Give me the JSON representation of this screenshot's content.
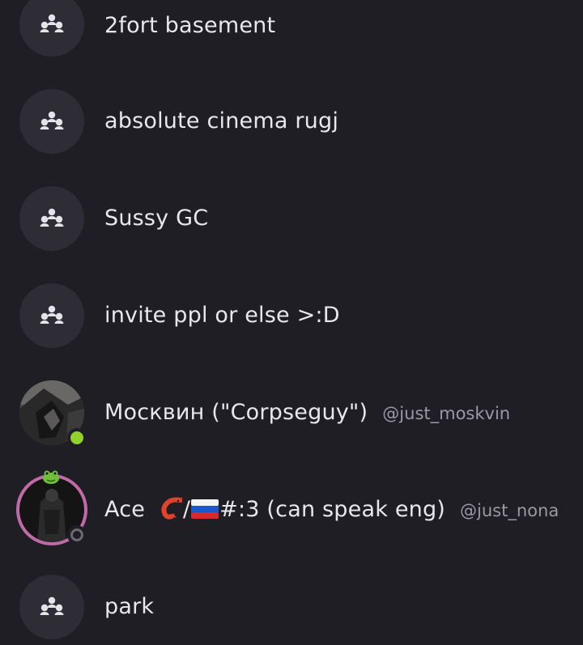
{
  "conversations": [
    {
      "type": "group",
      "name": "2fort basement",
      "icon": "group-icon"
    },
    {
      "type": "group",
      "name": "absolute cinema rugj",
      "icon": "group-icon"
    },
    {
      "type": "group",
      "name": "Sussy GC",
      "icon": "group-icon"
    },
    {
      "type": "group",
      "name": "invite ppl or else >:D",
      "icon": "group-icon"
    },
    {
      "type": "user",
      "name": "Москвин (\"Corpseguy\")",
      "handle": "@just_moskvin",
      "status": "online",
      "status_color": "#8fd22c"
    },
    {
      "type": "user",
      "name_prefix": "Ace ",
      "name_mid": "/",
      "name_suffix": "#:3 (can speak eng)",
      "handle": "@just_nona",
      "status": "offline",
      "emoji": [
        "shrimp-emoji",
        "russia-flag-emoji"
      ],
      "ring_color": "#c06aa8"
    },
    {
      "type": "group",
      "name": "park",
      "icon": "group-icon"
    }
  ],
  "colors": {
    "background": "#1f1e24",
    "avatar_bg": "#2e2d35",
    "text": "#e8e7ec",
    "handle": "#9a99a3"
  }
}
